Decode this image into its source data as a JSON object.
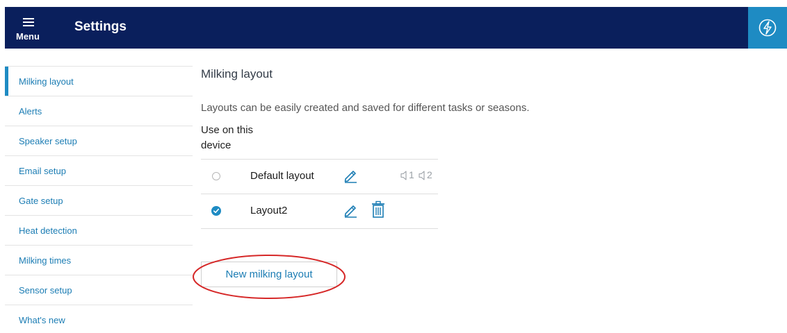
{
  "header": {
    "menu_label": "Menu",
    "title": "Settings",
    "menu_icon": "hamburger-icon",
    "action_icon": "lightning-bolt-icon"
  },
  "sidebar": {
    "items": [
      {
        "label": "Milking layout",
        "active": true
      },
      {
        "label": "Alerts"
      },
      {
        "label": "Speaker setup"
      },
      {
        "label": "Email setup"
      },
      {
        "label": "Gate setup"
      },
      {
        "label": "Heat detection"
      },
      {
        "label": "Milking times"
      },
      {
        "label": "Sensor setup"
      },
      {
        "label": "What's new"
      }
    ]
  },
  "main": {
    "title": "Milking layout",
    "description": "Layouts can be easily created and saved for different tasks or seasons.",
    "use_on_device_header": "Use on this device",
    "layouts": [
      {
        "name": "Default layout",
        "selected": false,
        "speakers": [
          "1",
          "2"
        ]
      },
      {
        "name": "Layout2",
        "selected": true
      }
    ],
    "new_layout_button": "New milking layout"
  },
  "colors": {
    "header_bg": "#0a1f5c",
    "accent": "#1e8bc3",
    "annotation": "#d62828"
  }
}
